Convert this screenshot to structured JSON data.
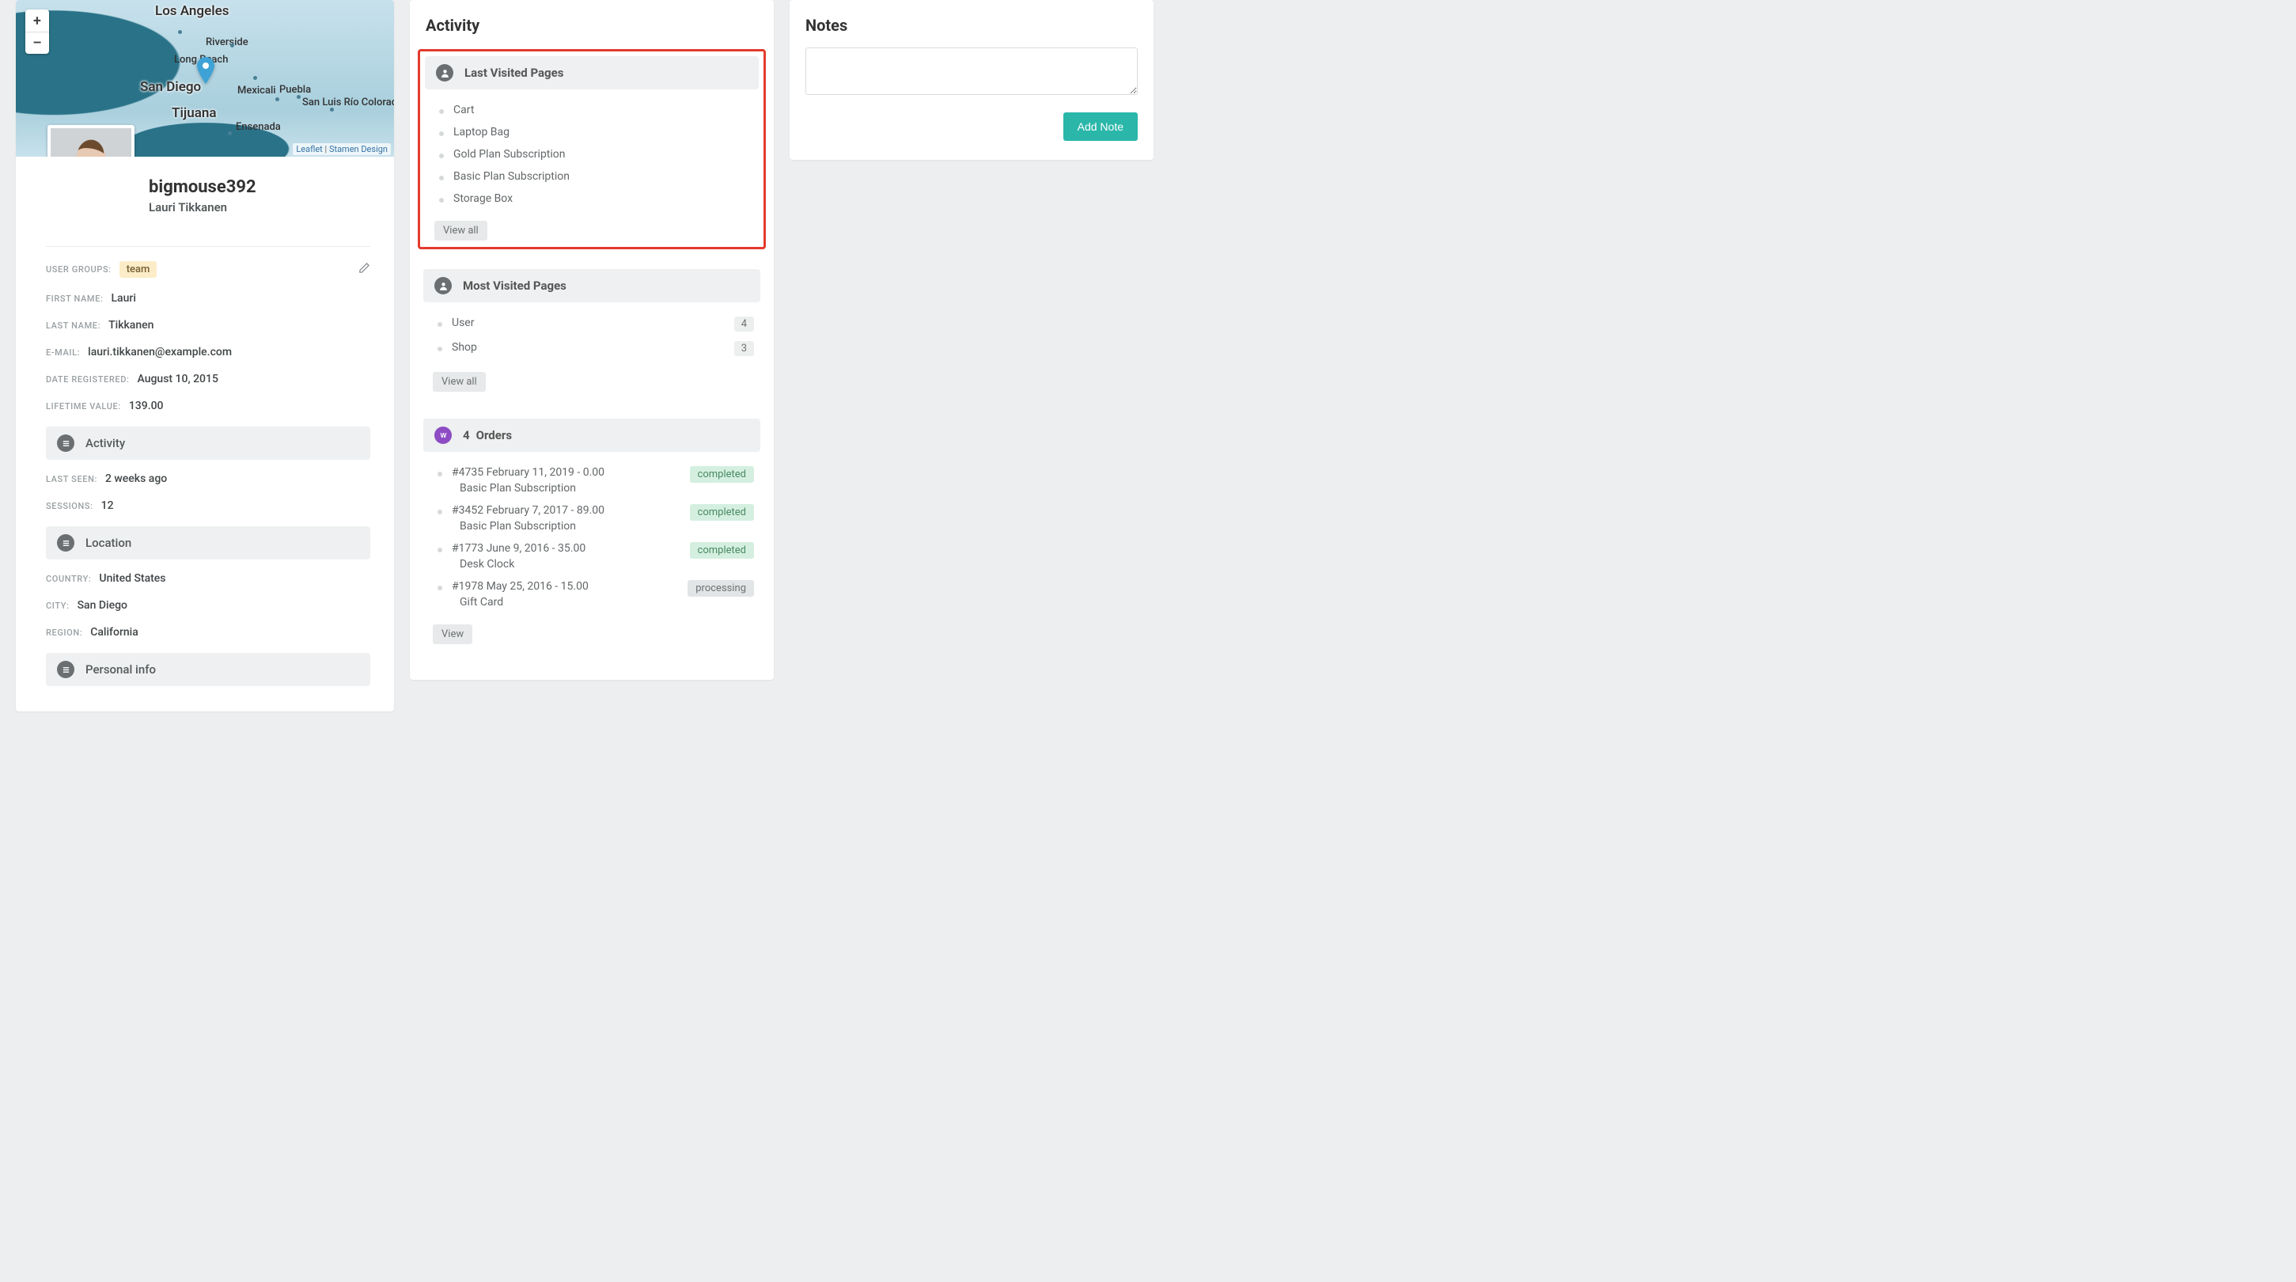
{
  "map": {
    "zoom_in": "+",
    "zoom_out": "–",
    "attribution_leaflet": "Leaflet",
    "attribution_sep": " | ",
    "attribution_stamen": "Stamen Design",
    "cities": {
      "los_angeles": "Los Angeles",
      "riverside": "Riverside",
      "long_beach": "Long Beach",
      "san_diego": "San Diego",
      "tijuana": "Tijuana",
      "mexicali": "Mexicali",
      "puebla": "Puebla",
      "ensenada": "Ensenada",
      "san_luis": "San Luis Río Colorado"
    }
  },
  "profile": {
    "username": "bigmouse392",
    "fullname": "Lauri Tikkanen"
  },
  "attrs": {
    "groups_label": "USER GROUPS:",
    "groups_tag": "team",
    "first_name_label": "FIRST NAME:",
    "first_name": "Lauri",
    "last_name_label": "LAST NAME:",
    "last_name": "Tikkanen",
    "email_label": "E-MAIL:",
    "email": "lauri.tikkanen@example.com",
    "date_reg_label": "DATE REGISTERED:",
    "date_reg": "August 10, 2015",
    "ltv_label": "LIFETIME VALUE:",
    "ltv": "139.00"
  },
  "left_sections": {
    "activity": "Activity",
    "last_seen_label": "LAST SEEN:",
    "last_seen": "2 weeks ago",
    "sessions_label": "SESSIONS:",
    "sessions": "12",
    "location": "Location",
    "country_label": "COUNTRY:",
    "country": "United States",
    "city_label": "CITY:",
    "city": "San Diego",
    "region_label": "REGION:",
    "region": "California",
    "personal": "Personal info"
  },
  "activity": {
    "title": "Activity",
    "last_visited": {
      "title": "Last Visited Pages",
      "items": [
        "Cart",
        "Laptop Bag",
        "Gold Plan Subscription",
        "Basic Plan Subscription",
        "Storage Box"
      ],
      "view_all": "View all"
    },
    "most_visited": {
      "title": "Most Visited Pages",
      "items": [
        {
          "label": "User",
          "count": "4"
        },
        {
          "label": "Shop",
          "count": "3"
        }
      ],
      "view_all": "View all"
    },
    "orders": {
      "count": "4",
      "title": "Orders",
      "items": [
        {
          "line1": "#4735 February 11, 2019 - 0.00",
          "line2": "Basic Plan Subscription",
          "status": "completed"
        },
        {
          "line1": "#3452 February 7, 2017 - 89.00",
          "line2": "Basic Plan Subscription",
          "status": "completed"
        },
        {
          "line1": "#1773 June 9, 2016 - 35.00",
          "line2": "Desk Clock",
          "status": "completed"
        },
        {
          "line1": "#1978 May 25, 2016 - 15.00",
          "line2": "Gift Card",
          "status": "processing"
        }
      ],
      "view": "View"
    }
  },
  "notes": {
    "title": "Notes",
    "add": "Add Note"
  }
}
